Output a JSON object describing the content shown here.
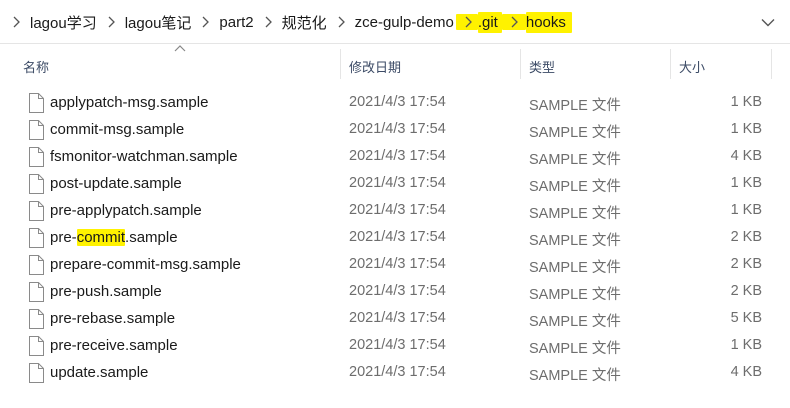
{
  "breadcrumb": {
    "items": [
      {
        "label": "lagou学习",
        "highlighted": false
      },
      {
        "label": "lagou笔记",
        "highlighted": false
      },
      {
        "label": "part2",
        "highlighted": false
      },
      {
        "label": "规范化",
        "highlighted": false
      },
      {
        "label": "zce-gulp-demo",
        "highlighted": false
      },
      {
        "label": ".git",
        "highlighted": true
      },
      {
        "label": "hooks",
        "highlighted": true
      }
    ],
    "separator_icon": "chevron-right-icon",
    "dropdown_icon": "chevron-down-icon"
  },
  "columns": {
    "name": "名称",
    "modified": "修改日期",
    "type": "类型",
    "size": "大小",
    "sort_indicator": "sort-ascending-icon"
  },
  "files": [
    {
      "name": "applypatch-msg.sample",
      "modified": "2021/4/3 17:54",
      "type": "SAMPLE 文件",
      "size": "1 KB"
    },
    {
      "name": "commit-msg.sample",
      "modified": "2021/4/3 17:54",
      "type": "SAMPLE 文件",
      "size": "1 KB"
    },
    {
      "name": "fsmonitor-watchman.sample",
      "modified": "2021/4/3 17:54",
      "type": "SAMPLE 文件",
      "size": "4 KB"
    },
    {
      "name": "post-update.sample",
      "modified": "2021/4/3 17:54",
      "type": "SAMPLE 文件",
      "size": "1 KB"
    },
    {
      "name": "pre-applypatch.sample",
      "modified": "2021/4/3 17:54",
      "type": "SAMPLE 文件",
      "size": "1 KB"
    },
    {
      "name": "pre-commit.sample",
      "name_parts": [
        "pre-",
        "commit",
        ".sample"
      ],
      "highlight_part": "commit",
      "modified": "2021/4/3 17:54",
      "type": "SAMPLE 文件",
      "size": "2 KB"
    },
    {
      "name": "prepare-commit-msg.sample",
      "modified": "2021/4/3 17:54",
      "type": "SAMPLE 文件",
      "size": "2 KB"
    },
    {
      "name": "pre-push.sample",
      "modified": "2021/4/3 17:54",
      "type": "SAMPLE 文件",
      "size": "2 KB"
    },
    {
      "name": "pre-rebase.sample",
      "modified": "2021/4/3 17:54",
      "type": "SAMPLE 文件",
      "size": "5 KB"
    },
    {
      "name": "pre-receive.sample",
      "modified": "2021/4/3 17:54",
      "type": "SAMPLE 文件",
      "size": "1 KB"
    },
    {
      "name": "update.sample",
      "modified": "2021/4/3 17:54",
      "type": "SAMPLE 文件",
      "size": "4 KB"
    }
  ],
  "colors": {
    "highlight": "#fff200",
    "header_text": "#3c4b66",
    "secondary_text": "#6d6d6d"
  }
}
